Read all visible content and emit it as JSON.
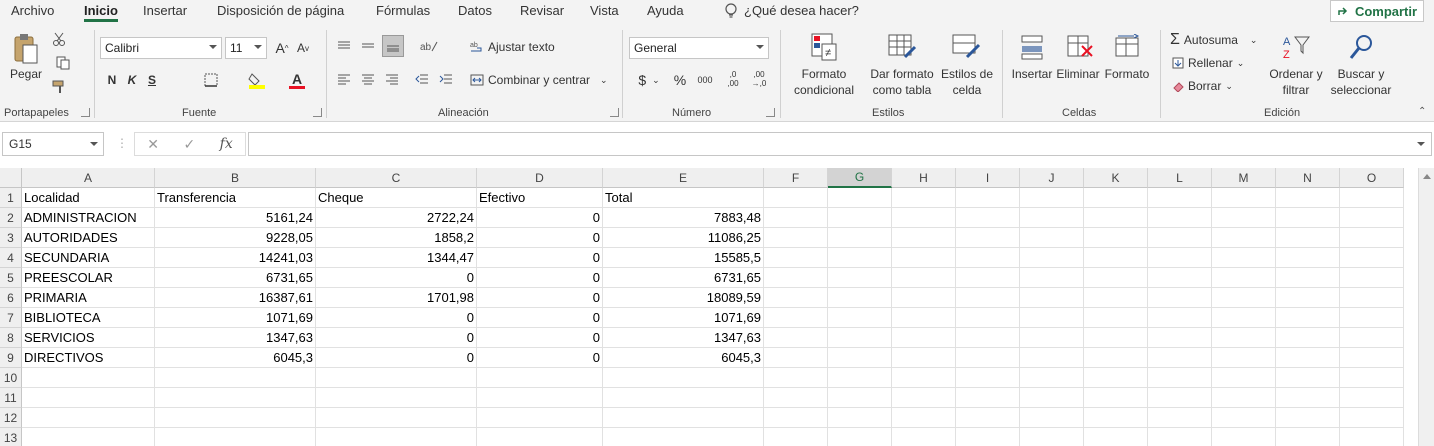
{
  "menu": {
    "tabs": [
      "Archivo",
      "Inicio",
      "Insertar",
      "Disposición de página",
      "Fórmulas",
      "Datos",
      "Revisar",
      "Vista",
      "Ayuda"
    ],
    "tell_me": "¿Qué desea hacer?",
    "share": "Compartir"
  },
  "ribbon": {
    "portapapeles": {
      "label": "Portapapeles",
      "pegar": "Pegar"
    },
    "fuente": {
      "label": "Fuente",
      "font_name": "Calibri",
      "font_size": "11",
      "bold": "N",
      "italic": "K",
      "underline": "S",
      "grow": "A",
      "shrink": "A",
      "font_color": "A"
    },
    "alineacion": {
      "label": "Alineación",
      "wrap": "Ajustar texto",
      "merge": "Combinar y centrar"
    },
    "numero": {
      "label": "Número",
      "format": "General",
      "currency": "$",
      "percent": "%",
      "thousands": "000",
      "inc_dec": ",0",
      "inc_dec2": ",00",
      "dec_dec": ",00",
      "dec_dec2": "→,0"
    },
    "estilos": {
      "label": "Estilos",
      "cond1": "Formato",
      "cond2": "condicional",
      "table1": "Dar formato",
      "table2": "como tabla",
      "cell1": "Estilos de",
      "cell2": "celda"
    },
    "celdas": {
      "label": "Celdas",
      "insert": "Insertar",
      "delete": "Eliminar",
      "format": "Formato"
    },
    "edicion": {
      "label": "Edición",
      "autosum": "Autosuma",
      "fill": "Rellenar",
      "clear": "Borrar",
      "sort1": "Ordenar y",
      "sort2": "filtrar",
      "find1": "Buscar y",
      "find2": "seleccionar"
    }
  },
  "formula_bar": {
    "name_box": "G15",
    "fx": "fx",
    "formula": ""
  },
  "sheet": {
    "columns": [
      "A",
      "B",
      "C",
      "D",
      "E",
      "F",
      "G",
      "H",
      "I",
      "J",
      "K",
      "L",
      "M",
      "N",
      "O"
    ],
    "selected_column": "G",
    "rows": [
      "1",
      "2",
      "3",
      "4",
      "5",
      "6",
      "7",
      "8",
      "9",
      "10",
      "11",
      "12",
      "13"
    ],
    "data": [
      [
        "Localidad",
        "Transferencia",
        "Cheque",
        "Efectivo",
        "Total"
      ],
      [
        "ADMINISTRACION",
        "5161,24",
        "2722,24",
        "0",
        "7883,48"
      ],
      [
        "AUTORIDADES",
        "9228,05",
        "1858,2",
        "0",
        "11086,25"
      ],
      [
        "SECUNDARIA",
        "14241,03",
        "1344,47",
        "0",
        "15585,5"
      ],
      [
        "PREESCOLAR",
        "6731,65",
        "0",
        "0",
        "6731,65"
      ],
      [
        "PRIMARIA",
        "16387,61",
        "1701,98",
        "0",
        "18089,59"
      ],
      [
        "BIBLIOTECA",
        "1071,69",
        "0",
        "0",
        "1071,69"
      ],
      [
        "SERVICIOS",
        "1347,63",
        "0",
        "0",
        "1347,63"
      ],
      [
        "DIRECTIVOS",
        "6045,3",
        "0",
        "0",
        "6045,3"
      ]
    ]
  },
  "colors": {
    "accent": "#217346",
    "highlight": "#ffff00",
    "font_red": "#e81123"
  }
}
